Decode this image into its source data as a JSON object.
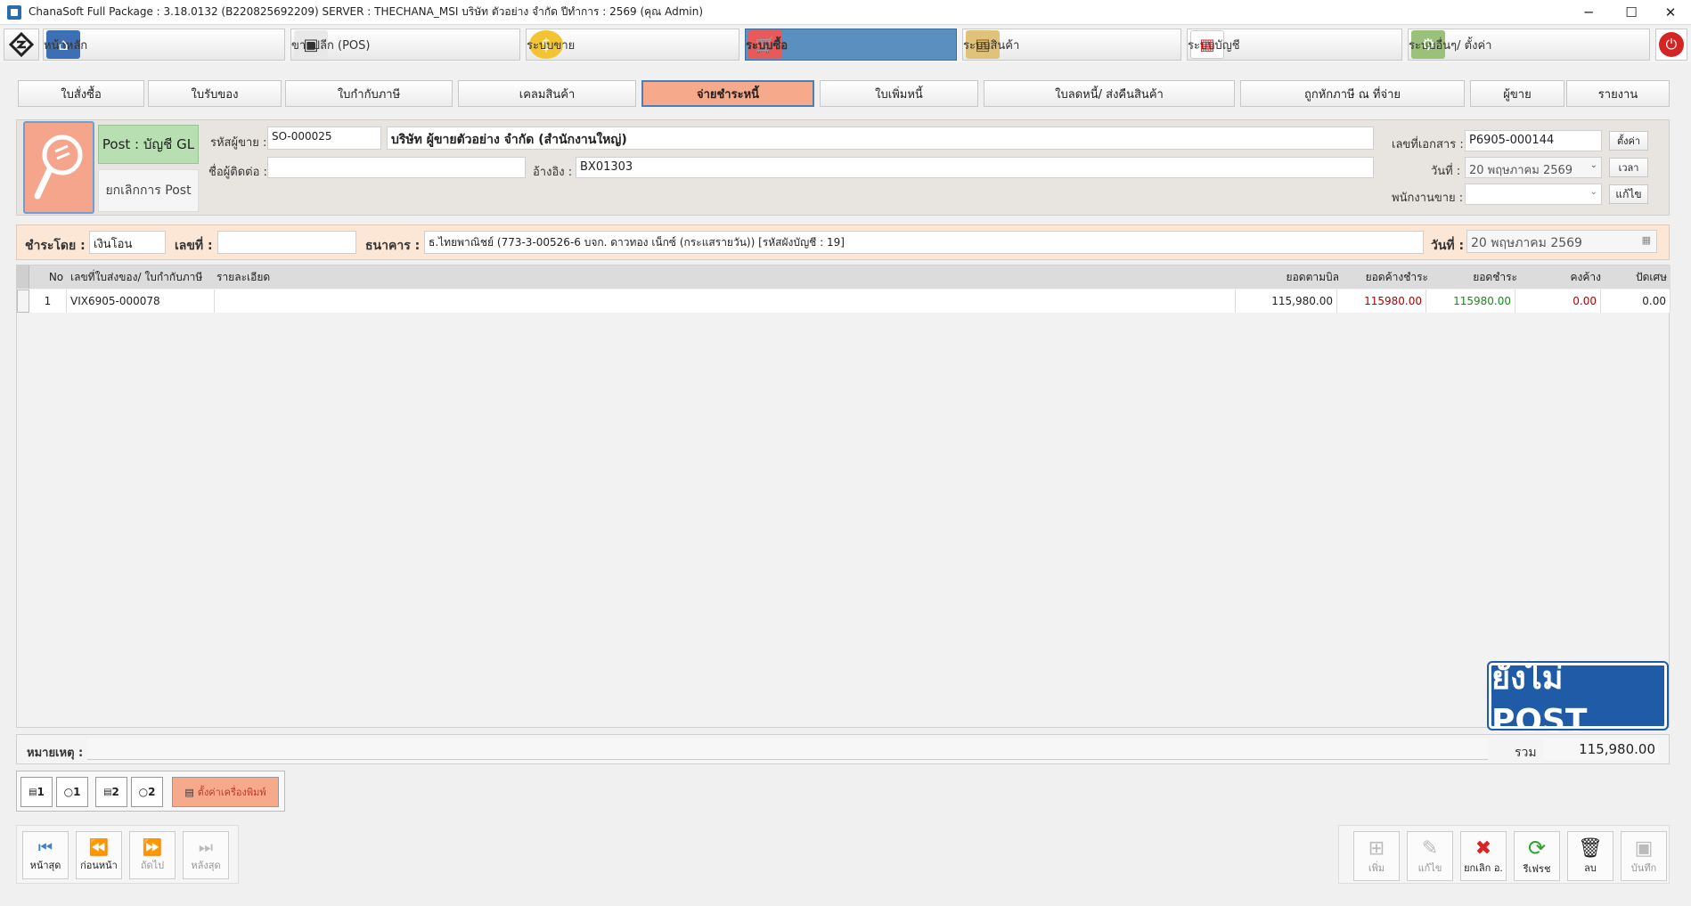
{
  "window": {
    "title": "ChanaSoft Full Package : 3.18.0132 (B220825692209) SERVER : THECHANA_MSI บริษัท ตัวอย่าง จำกัด ปีทำการ : 2569 (คุณ Admin)",
    "min": "─",
    "max": "☐",
    "close": "✕"
  },
  "nav": {
    "home": "หน้าหลัก",
    "pos": "ขายปลีก (POS)",
    "sales": "ระบบขาย",
    "purchase": "ระบบซื้อ",
    "inventory": "ระบบสินค้า",
    "accounting": "ระบบบัญชี",
    "other": "ระบบอื่นๆ/ ตั้งค่า"
  },
  "tabs": [
    "ใบสั่งซื้อ",
    "ใบรับของ",
    "ใบกำกับภาษี",
    "เคลมสินค้า",
    "จ่ายชำระหนี้",
    "ใบเพิ่มหนี้",
    "ใบลดหนี้/ ส่งคืนสินค้า",
    "ถูกหักภาษี ณ ที่จ่าย",
    "ผู้ขาย",
    "รายงาน"
  ],
  "header": {
    "post_gl": "Post : บัญชี GL",
    "unpost": "ยกเลิกการ Post",
    "vendor_code_label": "รหัสผู้ขาย :",
    "vendor_code": "SO-000025",
    "vendor_name": "บริษัท ผู้ขายตัวอย่าง จำกัด (สำนักงานใหญ่)",
    "contact_label": "ชื่อผู้ติดต่อ :",
    "contact": "",
    "ref_label": "อ้างอิง :",
    "ref": "BX01303",
    "docno_label": "เลขที่เอกสาร :",
    "docno": "P6905-000144",
    "setting_btn": "ตั้งค่า",
    "date_label": "วันที่ :",
    "date": "20 พฤษภาคม   2569",
    "time_btn": "เวลา",
    "salesman_label": "พนักงานขาย :",
    "salesman": "",
    "edit_btn": "แก้ไข"
  },
  "payment": {
    "by_label": "ชำระโดย :",
    "by": "เงินโอน",
    "no_label": "เลขที่ :",
    "no": "",
    "bank_label": "ธนาคาร :",
    "bank": "ธ.ไทยพาณิชย์ (773-3-00526-6 บจก. ดาวทอง เน็กซ์ (กระแสรายวัน)) [รหัสผังบัญชี : 19]",
    "date_label": "วันที่ :",
    "date": "20 พฤษภาคม   2569"
  },
  "grid": {
    "headers": [
      "No",
      "เลขที่ใบส่งของ/ ใบกำกับภาษี",
      "รายละเอียด",
      "ยอดตามบิล",
      "ยอดค้างชำระ",
      "ยอดชำระ",
      "คงค้าง",
      "ปัดเศษ"
    ],
    "rows": [
      {
        "no": "1",
        "doc": "VIX6905-000078",
        "detail": "",
        "bill": "115,980.00",
        "outstanding": "115980.00",
        "paid": "115980.00",
        "remain": "0.00",
        "round": "0.00"
      }
    ]
  },
  "stamp": "ยังไม่ POST",
  "footer": {
    "remark_label": "หมายเหตุ :",
    "remark": "",
    "total_label": "รวม",
    "total": "115,980.00"
  },
  "print": {
    "p1": "1",
    "p2": "1",
    "p3": "2",
    "p4": "2",
    "setup": "ตั้งค่าเครื่องพิมพ์"
  },
  "navbtns": {
    "first": "หน้าสุด",
    "prev": "ก่อนหน้า",
    "next": "ถัดไป",
    "last": "หลังสุด"
  },
  "actions": {
    "add": "เพิ่ม",
    "edit": "แก้ไข",
    "cancel": "ยกเลิก อ.",
    "refresh": "รีเฟรช",
    "delete": "ลบ",
    "save": "บันทึก"
  },
  "colors": {
    "accent": "#5b8fbf",
    "active_tab": "#f7a98c",
    "outstanding": "#b00000",
    "paid": "#1a8a1a",
    "stamp": "#1f5ba7"
  }
}
